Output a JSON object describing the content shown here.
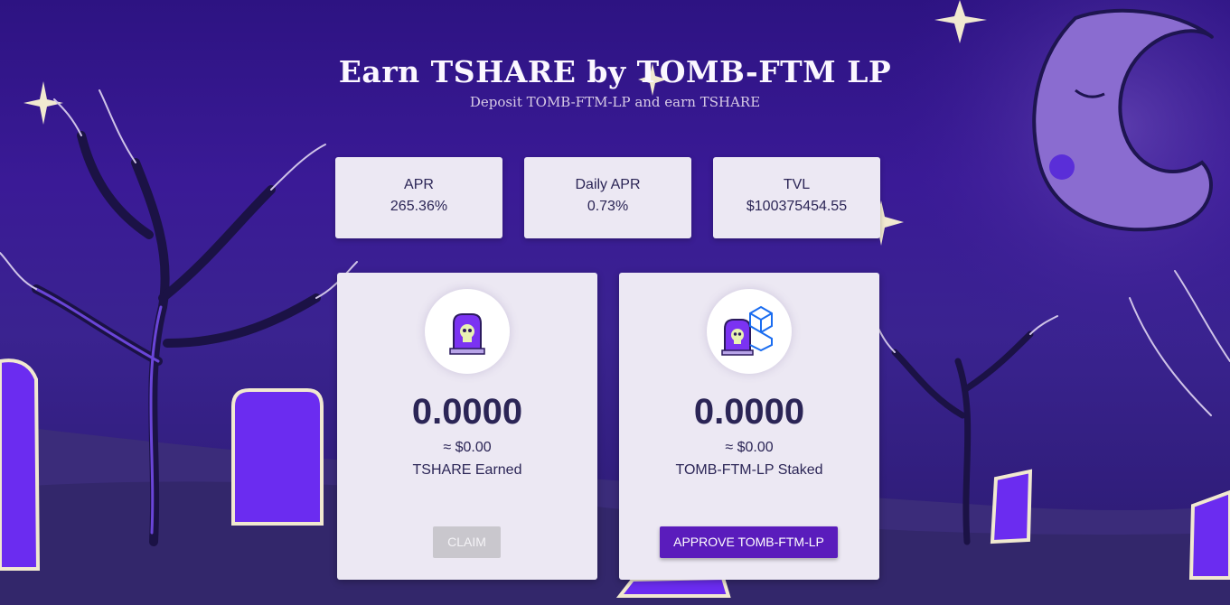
{
  "header": {
    "title": "Earn TSHARE by TOMB-FTM LP",
    "subtitle": "Deposit TOMB-FTM-LP and earn TSHARE"
  },
  "stats": [
    {
      "label": "APR",
      "value": "265.36%"
    },
    {
      "label": "Daily APR",
      "value": "0.73%"
    },
    {
      "label": "TVL",
      "value": "$100375454.55"
    }
  ],
  "earned_card": {
    "amount": "0.0000",
    "usd": "≈ $0.00",
    "label": "TSHARE Earned",
    "button_label": "CLAIM",
    "icon": "tshare-tombstone-icon"
  },
  "staked_card": {
    "amount": "0.0000",
    "usd": "≈ $0.00",
    "label": "TOMB-FTM-LP Staked",
    "button_label": "APPROVE TOMB-FTM-LP",
    "icon": "tomb-ftm-lp-icon"
  },
  "colors": {
    "background": "#2d1382",
    "card": "#ece8f3",
    "text": "#2b2556",
    "accent": "#5a1cbc",
    "disabled": "#c9c7cd"
  }
}
